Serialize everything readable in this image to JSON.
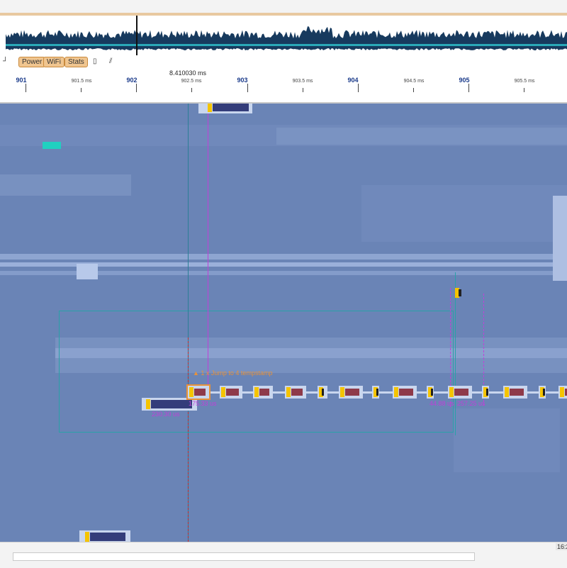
{
  "toolbar": {
    "chips": [
      "Power",
      "WiFi",
      "Stats"
    ],
    "icons": [
      "phone-icon",
      "wave-icon"
    ]
  },
  "ruler": {
    "cursor_time": "8.410030 ms",
    "major_ticks": [
      "901",
      "902",
      "903",
      "904",
      "905"
    ],
    "minor_ticks": [
      "901.5 ms",
      "902.5 ms",
      "903.5 ms",
      "904.5 ms",
      "905.5 ms"
    ]
  },
  "markers": {
    "label_a": "175.33 us",
    "label_b": "230.30 us",
    "label_c": "44.88 us",
    "label_d": "257.25 us",
    "callout": "▲ 1 x Jump to 4 tempstamp"
  },
  "status": {
    "corner": "16:2"
  },
  "colors": {
    "track_bg": "#6a84b6",
    "event_red": "#8e3a4a",
    "event_yellow": "#f5c400",
    "event_navy": "#343d7a",
    "marker": "#c040d8",
    "selection": "#2aa1a8"
  }
}
